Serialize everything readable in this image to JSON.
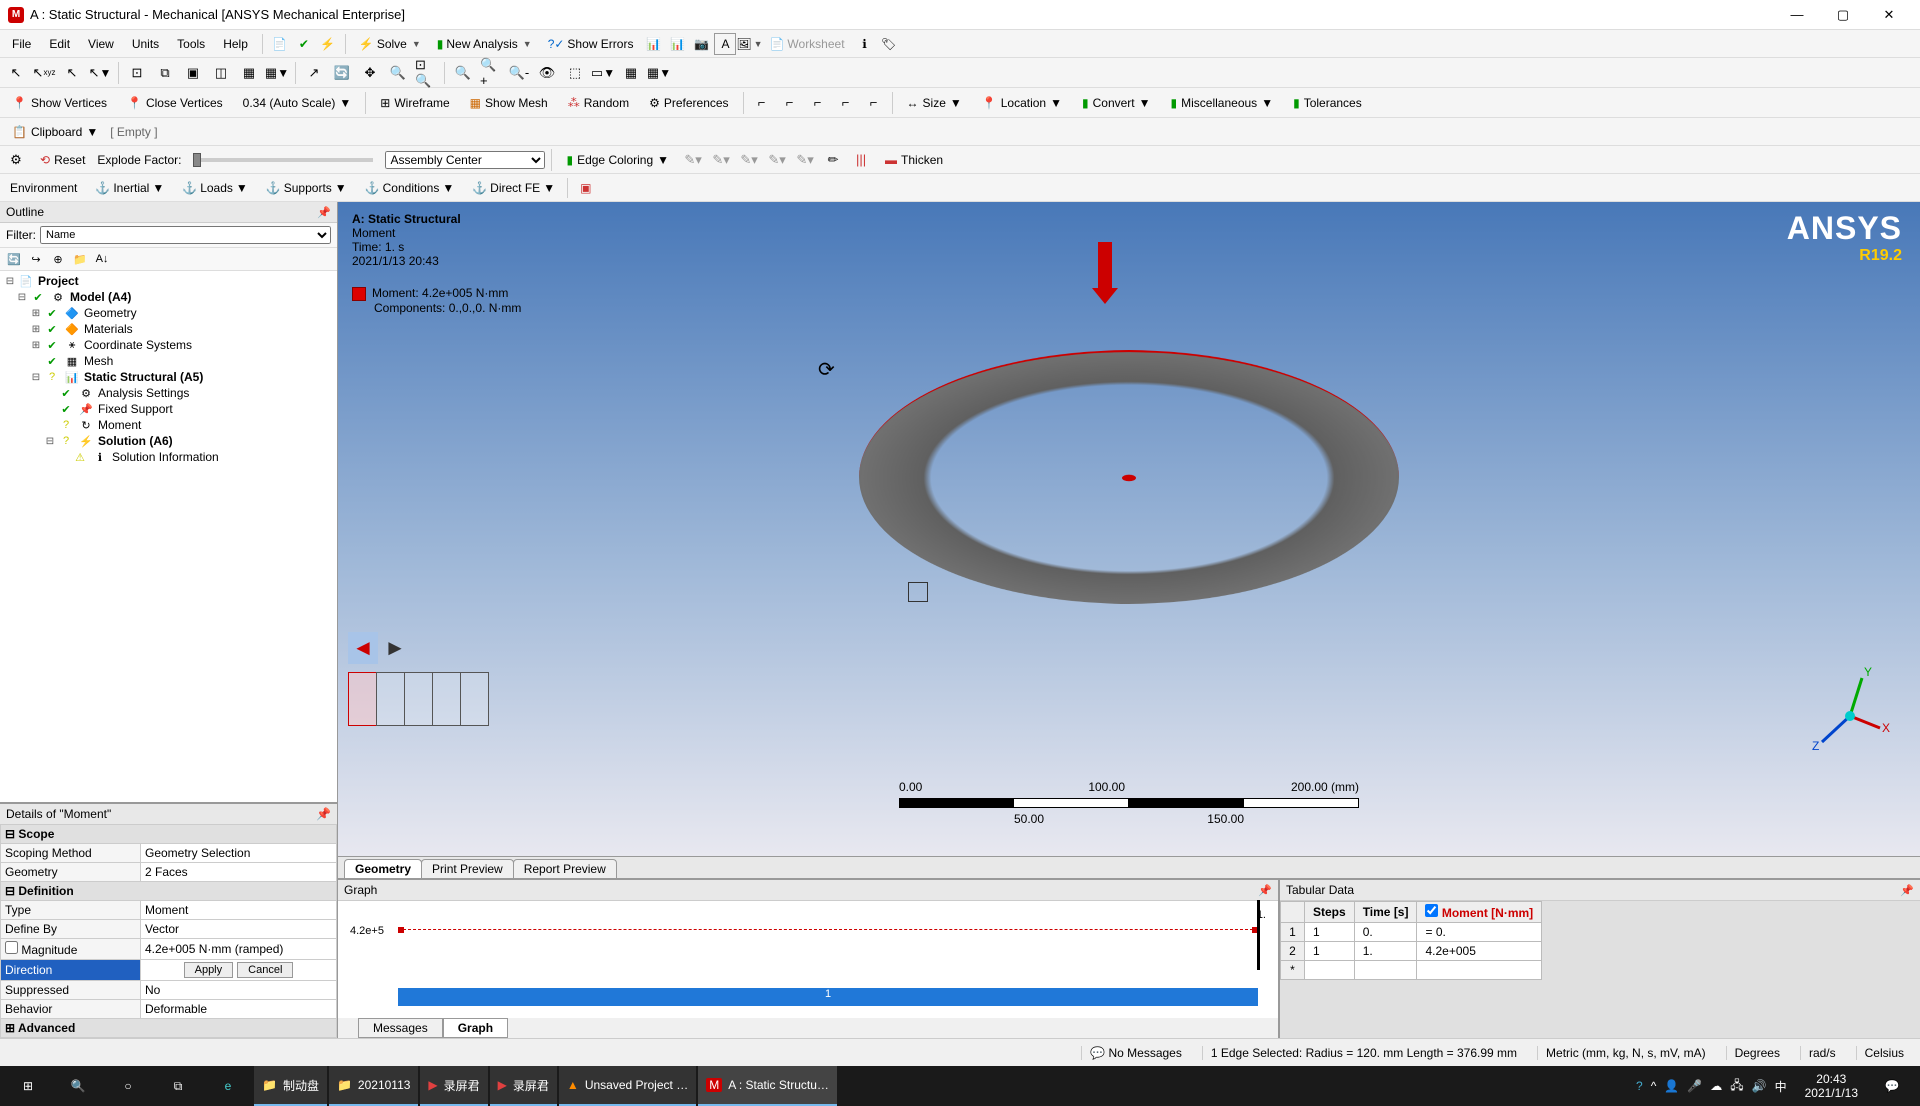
{
  "title": "A : Static Structural - Mechanical [ANSYS Mechanical Enterprise]",
  "menu": {
    "file": "File",
    "edit": "Edit",
    "view": "View",
    "units": "Units",
    "tools": "Tools",
    "help": "Help",
    "solve": "Solve",
    "newAnalysis": "New Analysis",
    "showErrors": "Show Errors",
    "worksheet": "Worksheet"
  },
  "toolbar3": {
    "showVertices": "Show Vertices",
    "closeVertices": "Close Vertices",
    "autoscale": "0.34 (Auto Scale)",
    "wireframe": "Wireframe",
    "showMesh": "Show Mesh",
    "random": "Random",
    "preferences": "Preferences",
    "size": "Size",
    "location": "Location",
    "convert": "Convert",
    "misc": "Miscellaneous",
    "tolerances": "Tolerances"
  },
  "clipboard": {
    "label": "Clipboard",
    "empty": "[ Empty ]"
  },
  "explode": {
    "reset": "Reset",
    "label": "Explode Factor:",
    "mode": "Assembly Center",
    "edgeColoring": "Edge Coloring",
    "thicken": "Thicken"
  },
  "envbar": {
    "environment": "Environment",
    "inertial": "Inertial",
    "loads": "Loads",
    "supports": "Supports",
    "conditions": "Conditions",
    "directFE": "Direct FE"
  },
  "outline": {
    "title": "Outline",
    "filterLabel": "Filter:",
    "filterValue": "Name",
    "tree": {
      "project": "Project",
      "model": "Model (A4)",
      "geometry": "Geometry",
      "materials": "Materials",
      "coord": "Coordinate Systems",
      "mesh": "Mesh",
      "structural": "Static Structural (A5)",
      "analysisSettings": "Analysis Settings",
      "fixedSupport": "Fixed Support",
      "moment": "Moment",
      "solution": "Solution (A6)",
      "solInfo": "Solution Information"
    }
  },
  "details": {
    "title": "Details of \"Moment\"",
    "groups": {
      "scope": "Scope",
      "definition": "Definition",
      "advanced": "Advanced"
    },
    "rows": {
      "scopingMethod": {
        "k": "Scoping Method",
        "v": "Geometry Selection"
      },
      "geometry": {
        "k": "Geometry",
        "v": "2 Faces"
      },
      "type": {
        "k": "Type",
        "v": "Moment"
      },
      "defineBy": {
        "k": "Define By",
        "v": "Vector"
      },
      "magnitude": {
        "k": "Magnitude",
        "v": "4.2e+005 N·mm (ramped)"
      },
      "direction": {
        "k": "Direction",
        "apply": "Apply",
        "cancel": "Cancel"
      },
      "suppressed": {
        "k": "Suppressed",
        "v": "No"
      },
      "behavior": {
        "k": "Behavior",
        "v": "Deformable"
      }
    }
  },
  "viewport": {
    "header": "A: Static Structural",
    "sub1": "Moment",
    "sub2": "Time: 1. s",
    "sub3": "2021/1/13 20:43",
    "legend1": "Moment: 4.2e+005 N·mm",
    "legend2": "Components: 0.,0.,0. N·mm",
    "brand": "ANSYS",
    "version": "R19.2",
    "scale": {
      "t0": "0.00",
      "t1": "50.00",
      "t2": "100.00",
      "t3": "150.00",
      "t4": "200.00 (mm)"
    },
    "tabs": {
      "geometry": "Geometry",
      "print": "Print Preview",
      "report": "Report Preview"
    }
  },
  "graph": {
    "title": "Graph",
    "yval": "4.2e+5",
    "xval": "1.",
    "xmid": "1",
    "tabs": {
      "messages": "Messages",
      "graph": "Graph"
    }
  },
  "tabular": {
    "title": "Tabular Data",
    "headers": {
      "steps": "Steps",
      "time": "Time [s]",
      "moment": "Moment [N·mm]"
    },
    "rows": [
      {
        "n": "1",
        "steps": "1",
        "time": "0.",
        "moment": "= 0."
      },
      {
        "n": "2",
        "steps": "1",
        "time": "1.",
        "moment": "4.2e+005"
      }
    ],
    "star": "*"
  },
  "status": {
    "noMessages": "No Messages",
    "selection": "1 Edge Selected: Radius = 120. mm  Length = 376.99 mm",
    "units": "Metric (mm, kg, N, s, mV, mA)",
    "deg": "Degrees",
    "rads": "rad/s",
    "cel": "Celsius"
  },
  "taskbar": {
    "items": [
      {
        "icon": "folder",
        "label": "制动盘",
        "color": "#ffb84d"
      },
      {
        "icon": "folder",
        "label": "20210113",
        "color": "#ffb84d"
      },
      {
        "icon": "rec",
        "label": "录屏君",
        "color": "#e04040"
      },
      {
        "icon": "rec",
        "label": "录屏君",
        "color": "#e04040"
      },
      {
        "icon": "ansys",
        "label": "Unsaved Project …",
        "color": "#ff8c00"
      },
      {
        "icon": "ansys-m",
        "label": "A : Static Structu…",
        "color": "#c00"
      }
    ],
    "time": "20:43",
    "date": "2021/1/13",
    "ime": "中"
  }
}
